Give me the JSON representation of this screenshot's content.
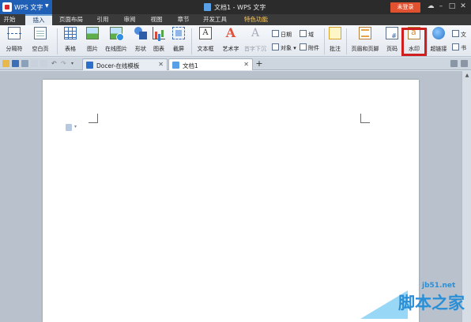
{
  "titlebar": {
    "app_name": "WPS 文字",
    "doc_title": "文档1 - WPS 文字",
    "login_label": "未登录"
  },
  "menu": {
    "tabs": [
      {
        "label": "开始"
      },
      {
        "label": "插入"
      },
      {
        "label": "页面布局"
      },
      {
        "label": "引用"
      },
      {
        "label": "审阅"
      },
      {
        "label": "视图"
      },
      {
        "label": "章节"
      },
      {
        "label": "开发工具"
      },
      {
        "label": "特色功能"
      }
    ],
    "active_tab": "插入"
  },
  "ribbon": {
    "page_break": "分隔符",
    "blank_page": "空白页",
    "table": "表格",
    "picture": "图片",
    "online_picture": "在线图片",
    "shape": "形状",
    "chart": "图表",
    "screenshot": "截屏",
    "textbox": "文本框",
    "wordart": "艺术字",
    "dropcap": "首字下沉",
    "date": "日期",
    "field": "域",
    "object": "对象",
    "attachment": "附件",
    "comment": "批注",
    "header_footer": "页眉和页脚",
    "page_number": "页码",
    "watermark": "水印",
    "hyperlink": "超链接",
    "more_1": "文",
    "more_2": "书"
  },
  "tabs": {
    "docer": "Docer-在线模板",
    "doc1": "文档1"
  },
  "site_watermark": {
    "url": "jb51.net",
    "name": "脚本之家"
  },
  "colors": {
    "titlebar": "#2b2b2b",
    "app_button": "#1f5fb5",
    "login_button": "#e0522f",
    "highlight_box": "#d01f1f",
    "site_brand": "#2a8fd6"
  }
}
